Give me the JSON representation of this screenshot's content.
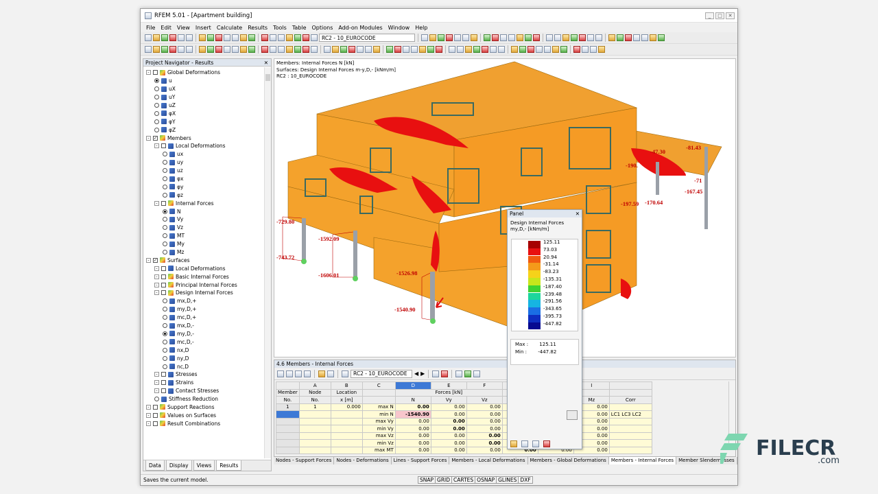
{
  "app": {
    "title": "RFEM 5.01 - [Apartment building]"
  },
  "menu": [
    "File",
    "Edit",
    "View",
    "Insert",
    "Calculate",
    "Results",
    "Tools",
    "Table",
    "Options",
    "Add-on Modules",
    "Window",
    "Help"
  ],
  "toolbar": {
    "combo": "RC2 - 10_EUROCODE"
  },
  "navigator": {
    "title": "Project Navigator - Results",
    "tree": [
      {
        "label": "Global Deformations",
        "level": 0,
        "kind": "group"
      },
      {
        "label": "u",
        "level": 1,
        "kind": "radio",
        "on": true
      },
      {
        "label": "uX",
        "level": 1,
        "kind": "radio"
      },
      {
        "label": "uY",
        "level": 1,
        "kind": "radio"
      },
      {
        "label": "uZ",
        "level": 1,
        "kind": "radio"
      },
      {
        "label": "φX",
        "level": 1,
        "kind": "radio"
      },
      {
        "label": "φY",
        "level": 1,
        "kind": "radio"
      },
      {
        "label": "φZ",
        "level": 1,
        "kind": "radio"
      },
      {
        "label": "Members",
        "level": 0,
        "kind": "group",
        "checked": true
      },
      {
        "label": "Local Deformations",
        "level": 1,
        "kind": "group"
      },
      {
        "label": "ux",
        "level": 2,
        "kind": "radio"
      },
      {
        "label": "uy",
        "level": 2,
        "kind": "radio"
      },
      {
        "label": "uz",
        "level": 2,
        "kind": "radio"
      },
      {
        "label": "φx",
        "level": 2,
        "kind": "radio"
      },
      {
        "label": "φy",
        "level": 2,
        "kind": "radio"
      },
      {
        "label": "φz",
        "level": 2,
        "kind": "radio"
      },
      {
        "label": "Internal Forces",
        "level": 1,
        "kind": "group"
      },
      {
        "label": "N",
        "level": 2,
        "kind": "radio",
        "on": true
      },
      {
        "label": "Vy",
        "level": 2,
        "kind": "radio"
      },
      {
        "label": "Vz",
        "level": 2,
        "kind": "radio"
      },
      {
        "label": "MT",
        "level": 2,
        "kind": "radio"
      },
      {
        "label": "My",
        "level": 2,
        "kind": "radio"
      },
      {
        "label": "Mz",
        "level": 2,
        "kind": "radio"
      },
      {
        "label": "Surfaces",
        "level": 0,
        "kind": "group",
        "checked": true
      },
      {
        "label": "Local Deformations",
        "level": 1,
        "kind": "group"
      },
      {
        "label": "Basic Internal Forces",
        "level": 1,
        "kind": "group"
      },
      {
        "label": "Principal Internal Forces",
        "level": 1,
        "kind": "group"
      },
      {
        "label": "Design Internal Forces",
        "level": 1,
        "kind": "group"
      },
      {
        "label": "mx,D,+",
        "level": 2,
        "kind": "radio"
      },
      {
        "label": "my,D,+",
        "level": 2,
        "kind": "radio"
      },
      {
        "label": "mc,D,+",
        "level": 2,
        "kind": "radio"
      },
      {
        "label": "mx,D,-",
        "level": 2,
        "kind": "radio"
      },
      {
        "label": "my,D,-",
        "level": 2,
        "kind": "radio",
        "on": true
      },
      {
        "label": "mc,D,-",
        "level": 2,
        "kind": "radio"
      },
      {
        "label": "nx,D",
        "level": 2,
        "kind": "radio"
      },
      {
        "label": "ny,D",
        "level": 2,
        "kind": "radio"
      },
      {
        "label": "nc,D",
        "level": 2,
        "kind": "radio"
      },
      {
        "label": "Stresses",
        "level": 1,
        "kind": "group"
      },
      {
        "label": "Strains",
        "level": 1,
        "kind": "group"
      },
      {
        "label": "Contact Stresses",
        "level": 1,
        "kind": "group"
      },
      {
        "label": "Stiffness Reduction",
        "level": 1,
        "kind": "radio"
      },
      {
        "label": "Support Reactions",
        "level": 0,
        "kind": "group"
      },
      {
        "label": "Values on Surfaces",
        "level": 0,
        "kind": "group"
      },
      {
        "label": "Result Combinations",
        "level": 0,
        "kind": "group"
      }
    ],
    "tabs": [
      "Data",
      "Display",
      "Views",
      "Results"
    ]
  },
  "view": {
    "info": [
      "Members: Internal Forces N [kN]",
      "Surfaces: Design Internal Forces m-y,D,- [kNm/m]",
      "RC2 : 10_EUROCODE"
    ],
    "labels": [
      "-729.80",
      "-743.72",
      "-1592.09",
      "-1606.01",
      "-1526.98",
      "-1540.90",
      "-81.43",
      "-47.30",
      "-190.",
      "-71",
      "-167.45",
      "-197.59",
      "-170.64"
    ]
  },
  "panel": {
    "title": "Panel",
    "heading": "Design Internal Forces",
    "unit": "my,D,- [kNm/m]",
    "legend": [
      {
        "v": "125.11",
        "c": "#a60000"
      },
      {
        "v": "73.03",
        "c": "#e81010"
      },
      {
        "v": "20.94",
        "c": "#f05a10"
      },
      {
        "v": "-31.14",
        "c": "#f49a1a"
      },
      {
        "v": "-83.23",
        "c": "#f6d21a"
      },
      {
        "v": "-135.31",
        "c": "#c8e61c"
      },
      {
        "v": "-187.40",
        "c": "#3fd232"
      },
      {
        "v": "-239.48",
        "c": "#1cd69c"
      },
      {
        "v": "-291.56",
        "c": "#16b4e2"
      },
      {
        "v": "-343.65",
        "c": "#1a6ee4"
      },
      {
        "v": "-395.73",
        "c": "#0e2ec0"
      },
      {
        "v": "-447.82",
        "c": "#060a90"
      }
    ],
    "max_label": "Max :",
    "max": "125.11",
    "min_label": "Min :",
    "min": "-447.82"
  },
  "table": {
    "title": "4.6 Members - Internal Forces",
    "combo": "RC2 - 10_EUROCODE",
    "col_letters": [
      "A",
      "B",
      "C",
      "D",
      "E",
      "F",
      "G",
      "H",
      "I"
    ],
    "group_forces": "Forces [kN]",
    "group_moments": "Moments [kNm]",
    "h_member": "Member",
    "h_member2": "No.",
    "h_node": "Node",
    "h_node2": "No.",
    "h_loc": "Location",
    "h_loc2": "x [m]",
    "h_N": "N",
    "h_Vy": "Vy",
    "h_Vz": "Vz",
    "h_MT": "MT",
    "h_My": "My",
    "h_Mz": "Mz",
    "h_corr": "Corr",
    "rows": [
      {
        "member": "1",
        "node": "1",
        "x": "0.000",
        "label": "max N",
        "N": "0.00",
        "Vy": "0.00",
        "Vz": "0.00",
        "MT": "0.00",
        "My": "0.00",
        "Mz": "0.00",
        "corr": ""
      },
      {
        "member": "",
        "node": "",
        "x": "",
        "label": "min N",
        "N": "-1540.90",
        "Vy": "0.00",
        "Vz": "0.00",
        "MT": "0.00",
        "My": "0.00",
        "Mz": "0.00",
        "corr": "LC1 LC3 LC2"
      },
      {
        "member": "",
        "node": "",
        "x": "",
        "label": "max Vy",
        "N": "0.00",
        "Vy": "0.00",
        "Vz": "0.00",
        "MT": "0.00",
        "My": "0.00",
        "Mz": "0.00",
        "corr": ""
      },
      {
        "member": "",
        "node": "",
        "x": "",
        "label": "min Vy",
        "N": "0.00",
        "Vy": "0.00",
        "Vz": "0.00",
        "MT": "0.00",
        "My": "0.00",
        "Mz": "0.00",
        "corr": ""
      },
      {
        "member": "",
        "node": "",
        "x": "",
        "label": "max Vz",
        "N": "0.00",
        "Vy": "0.00",
        "Vz": "0.00",
        "MT": "0.00",
        "My": "0.00",
        "Mz": "0.00",
        "corr": ""
      },
      {
        "member": "",
        "node": "",
        "x": "",
        "label": "min Vz",
        "N": "0.00",
        "Vy": "0.00",
        "Vz": "0.00",
        "MT": "0.00",
        "My": "0.00",
        "Mz": "0.00",
        "corr": ""
      },
      {
        "member": "",
        "node": "",
        "x": "",
        "label": "max MT",
        "N": "0.00",
        "Vy": "0.00",
        "Vz": "0.00",
        "MT": "0.00",
        "My": "0.00",
        "Mz": "0.00",
        "corr": ""
      }
    ],
    "tabs": [
      "Nodes - Support Forces",
      "Nodes - Deformations",
      "Lines - Support Forces",
      "Members - Local Deformations",
      "Members - Global Deformations",
      "Members - Internal Forces",
      "Member Slendernesses"
    ]
  },
  "status": {
    "text": "Saves the current model.",
    "buttons": [
      "SNAP",
      "GRID",
      "CARTES",
      "OSNAP",
      "GLINES",
      "DXF"
    ]
  },
  "watermark": {
    "name": "FILECR",
    "sub": ".com"
  }
}
